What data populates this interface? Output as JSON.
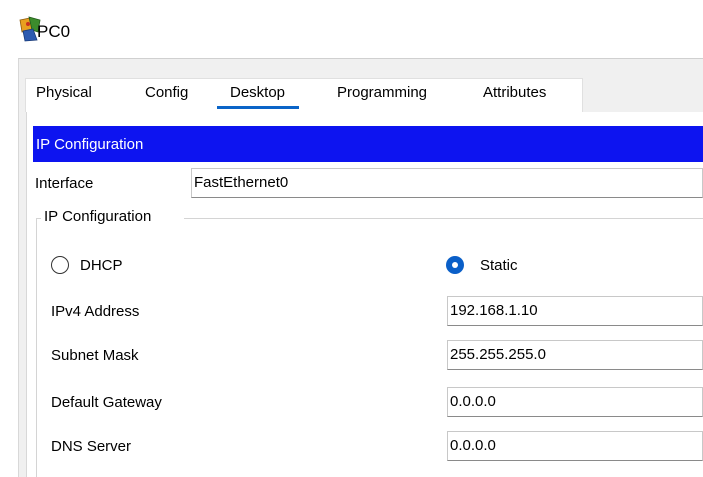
{
  "window": {
    "title": "PC0"
  },
  "tabs": [
    {
      "label": "Physical"
    },
    {
      "label": "Config"
    },
    {
      "label": "Desktop"
    },
    {
      "label": "Programming"
    },
    {
      "label": "Attributes"
    }
  ],
  "active_tab": "Desktop",
  "ip_config": {
    "header": "IP Configuration",
    "interface_label": "Interface",
    "interface_value": "FastEthernet0",
    "group_label": "IP Configuration",
    "mode_options": [
      {
        "label": "DHCP",
        "selected": false
      },
      {
        "label": "Static",
        "selected": true
      }
    ],
    "fields": {
      "ipv4_label": "IPv4 Address",
      "ipv4_value": "192.168.1.10",
      "subnet_label": "Subnet Mask",
      "subnet_value": "255.255.255.0",
      "gateway_label": "Default Gateway",
      "gateway_value": "0.0.0.0",
      "dns_label": "DNS Server",
      "dns_value": "0.0.0.0"
    }
  },
  "colors": {
    "header_bg": "#0d14f0",
    "tab_underline": "#0a64c8",
    "radio_selected": "#0a5fc8"
  },
  "icons": {
    "title_icon": "pc-device-icon"
  }
}
